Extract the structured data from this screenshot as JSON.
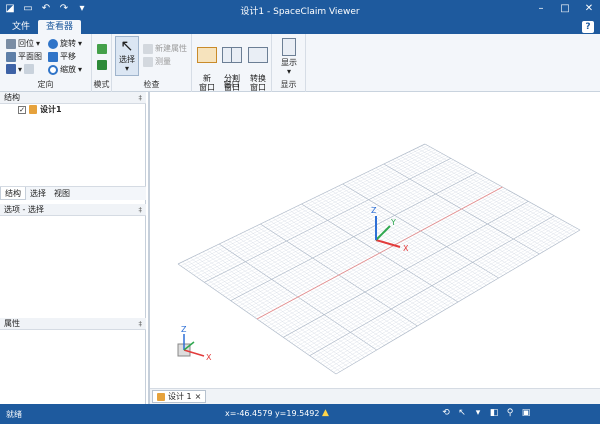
{
  "window": {
    "title": "设计1 - SpaceClaim Viewer"
  },
  "tabs": [
    {
      "label": "文件"
    },
    {
      "label": "查看器"
    }
  ],
  "help_label": "?",
  "ribbon": {
    "orient": {
      "label": "定向",
      "items": [
        "回位",
        "平面图",
        "旋转",
        "平移",
        "缩放"
      ]
    },
    "mode": {
      "label": "模式"
    },
    "inspect": {
      "label": "检查",
      "select": "选择",
      "new_props": "新建属性",
      "measure": "测量"
    },
    "window_grp": {
      "label": "窗口",
      "new_window": "新\n窗口",
      "split": "分割\n窗口",
      "switch": "转换\n窗口"
    },
    "display": {
      "label": "显示",
      "show": "显示"
    }
  },
  "panels": {
    "structure": {
      "title": "结构",
      "root": "设计1",
      "checked": "✓"
    },
    "panel_tabs": [
      "结构",
      "选择",
      "视图"
    ],
    "options": {
      "title": "选项 - 选择"
    },
    "properties": {
      "title": "属性"
    },
    "pin": "‡"
  },
  "viewport": {
    "doc_tab": "设计 1",
    "axes": {
      "x": "X",
      "y": "Y",
      "z": "Z"
    },
    "accent": {
      "x": "#e23b3b",
      "y": "#2fa84f",
      "z": "#2d6fd6"
    }
  },
  "status": {
    "ready": "就绪",
    "coords": "x=-46.4579  y=19.5492",
    "warn": "▲"
  }
}
